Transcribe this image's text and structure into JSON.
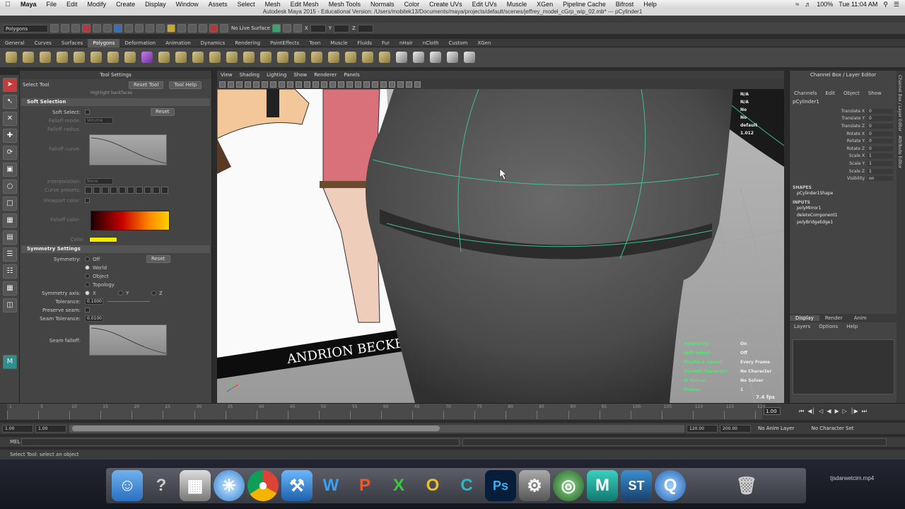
{
  "macmenu": {
    "app": "Maya",
    "items": [
      "File",
      "Edit",
      "Modify",
      "Create",
      "Display",
      "Window",
      "Assets",
      "Select",
      "Mesh",
      "Edit Mesh",
      "Mesh Tools",
      "Normals",
      "Color",
      "Create UVs",
      "Edit UVs",
      "Muscle",
      "XGen",
      "Pipeline Cache",
      "Bifrost",
      "Help"
    ],
    "battery": "100%",
    "clock": "Tue 11:04 AM"
  },
  "window_title": "Autodesk Maya 2015 - Educational Version: /Users/mobilek13/Documents/maya/projects/default/scenes/jeffrey_model_cGrp_wip_02.mb* --- pCylinder1",
  "status_line": {
    "mode_dropdown": "Polygons",
    "live_surface": "No Live Surface",
    "coord_labels": [
      "X",
      "Y",
      "Z"
    ]
  },
  "shelf_tabs": [
    "General",
    "Curves",
    "Surfaces",
    "Polygons",
    "Deformation",
    "Animation",
    "Dynamics",
    "Rendering",
    "PaintEffects",
    "Toon",
    "Muscle",
    "Fluids",
    "Fur",
    "nHair",
    "nCloth",
    "Custom",
    "XGen"
  ],
  "shelf_active_tab": "Polygons",
  "tool_settings": {
    "header": "Tool Settings",
    "tool_name": "Select Tool",
    "reset_tool": "Reset Tool",
    "tool_help": "Tool Help",
    "highlight_label": "Highlight backfaces",
    "soft_selection": {
      "title": "Soft Selection",
      "soft_select": "Soft Select:",
      "reset": "Reset",
      "falloff_mode": "Falloff mode:",
      "falloff_mode_value": "Volume",
      "falloff_radius": "Falloff radius:",
      "falloff_curve": "Falloff curve:",
      "interpolation": "Interpolation:",
      "interpolation_value": "None",
      "curve_presets": "Curve presets:",
      "viewport_color": "Viewport color:",
      "falloff_color": "Falloff color:",
      "color": "Color:"
    },
    "symmetry": {
      "title": "Symmetry Settings",
      "symmetry_label": "Symmetry:",
      "reset": "Reset",
      "options": [
        "Off",
        "World",
        "Object",
        "Topology"
      ],
      "selected": "World",
      "axis_label": "Symmetry axis:",
      "axes": [
        "X",
        "Y",
        "Z"
      ],
      "tolerance_label": "Tolerance:",
      "tolerance_value": "0.1000",
      "preserve_seam": "Preserve seam:",
      "seam_tolerance": "Seam Tolerance:",
      "seam_tolerance_value": "0.0100",
      "seam_falloff": "Seam falloff:"
    }
  },
  "viewport": {
    "menu": [
      "View",
      "Shading",
      "Lighting",
      "Show",
      "Renderer",
      "Panels"
    ],
    "artwork_text": "ANDRION BECKER",
    "hud_labels": [
      "Symmetry:",
      "Soft Select:",
      "Playback Speed:",
      "Current Character:",
      "IK Solver:",
      "Frame:"
    ],
    "hud_values": [
      "On",
      "Off",
      "Every Frame",
      "No Character",
      "No Solver",
      "1"
    ],
    "fps": "7.4 fps",
    "hud_top_values": [
      "N/A",
      "N/A",
      "No",
      "No",
      "default",
      "1.012"
    ]
  },
  "channel_box": {
    "header": "Channel Box / Layer Editor",
    "menu": [
      "Channels",
      "Edit",
      "Object",
      "Show"
    ],
    "object": "pCylinder1",
    "attributes": [
      {
        "name": "Translate X",
        "value": "0"
      },
      {
        "name": "Translate Y",
        "value": "0"
      },
      {
        "name": "Translate Z",
        "value": "0"
      },
      {
        "name": "Rotate X",
        "value": "0"
      },
      {
        "name": "Rotate Y",
        "value": "0"
      },
      {
        "name": "Rotate Z",
        "value": "0"
      },
      {
        "name": "Scale X",
        "value": "1"
      },
      {
        "name": "Scale Y",
        "value": "1"
      },
      {
        "name": "Scale Z",
        "value": "1"
      },
      {
        "name": "Visibility",
        "value": "on"
      }
    ],
    "shapes_header": "SHAPES",
    "shapes": [
      "pCylinder1Shape"
    ],
    "inputs_header": "INPUTS",
    "inputs": [
      "polyMirror1",
      "deleteComponent1",
      "polyBridgeEdge1"
    ],
    "layer_tabs": [
      "Display",
      "Render",
      "Anim"
    ],
    "layer_menu": [
      "Layers",
      "Options",
      "Help"
    ],
    "side_tabs": [
      "Channel Box / Layer Editor",
      "Attribute Editor"
    ]
  },
  "timeline": {
    "ticks": [
      "1",
      "5",
      "10",
      "15",
      "20",
      "25",
      "30",
      "35",
      "40",
      "45",
      "50",
      "55",
      "60",
      "65",
      "70",
      "75",
      "80",
      "85",
      "90",
      "95",
      "100",
      "105",
      "110",
      "115",
      "120"
    ],
    "current_frame": "1.00"
  },
  "range": {
    "start": "1.00",
    "start2": "1.00",
    "slider_start": "1",
    "slider_end": "120",
    "end": "120.00",
    "end2": "200.00",
    "anim_layer": "No Anim Layer",
    "character": "No Character Set"
  },
  "command_line": {
    "label": "MEL"
  },
  "help_line": "Select Tool: select an object",
  "dock": {
    "apps": [
      "Finder",
      "Help",
      "Preview",
      "Safari",
      "Chrome",
      "Xcode",
      "Word",
      "PowerPoint",
      "Excel",
      "Outlook",
      "C",
      "Photoshop",
      "Settings",
      "Maya Icon",
      "Maya",
      "ST",
      "QuickTime",
      "Trash"
    ],
    "watermark": "tjsdarwetcim.mp4"
  }
}
